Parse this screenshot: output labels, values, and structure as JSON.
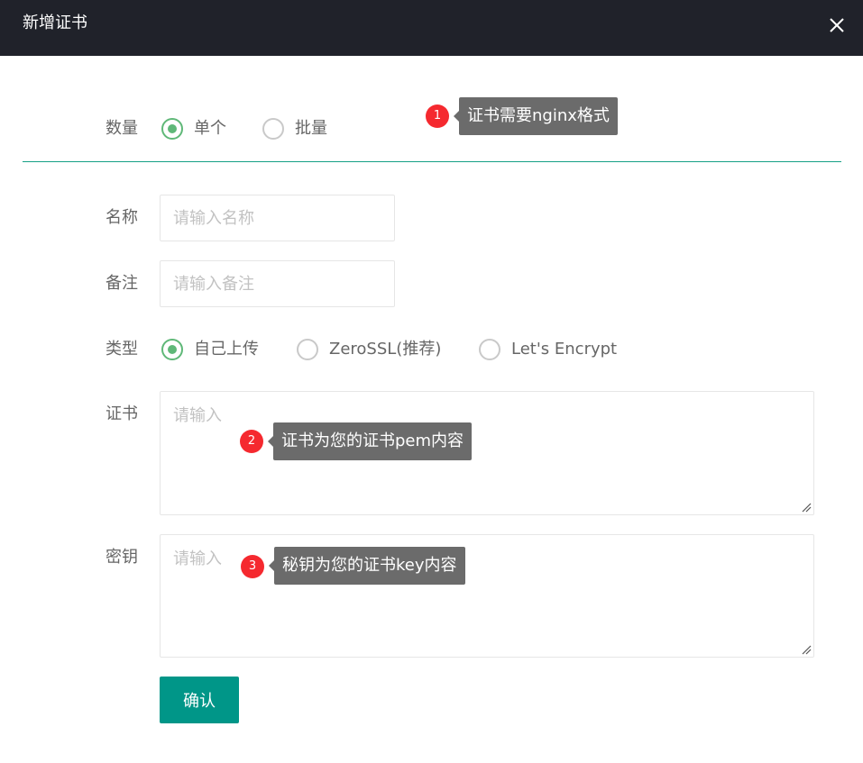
{
  "dialog": {
    "title": "新增证书"
  },
  "form": {
    "quantity": {
      "label": "数量",
      "options": [
        "单个",
        "批量"
      ],
      "selected": "单个"
    },
    "name": {
      "label": "名称",
      "placeholder": "请输入名称",
      "value": ""
    },
    "remark": {
      "label": "备注",
      "placeholder": "请输入备注",
      "value": ""
    },
    "type": {
      "label": "类型",
      "options": [
        "自己上传",
        "ZeroSSL(推荐)",
        "Let's Encrypt"
      ],
      "selected": "自己上传"
    },
    "certificate": {
      "label": "证书",
      "placeholder": "请输入",
      "value": ""
    },
    "key": {
      "label": "密钥",
      "placeholder": "请输入",
      "value": ""
    },
    "submit_label": "确认"
  },
  "annotations": [
    {
      "number": "1",
      "text": "证书需要nginx格式"
    },
    {
      "number": "2",
      "text": "证书为您的证书pem内容"
    },
    {
      "number": "3",
      "text": "秘钥为您的证书key内容"
    }
  ],
  "colors": {
    "header_bg": "#20222a",
    "radio_checked": "#5fb878",
    "divider": "#16a085",
    "primary_button": "#009688",
    "annotation_badge": "#f5292f",
    "annotation_tip": "#6b6b6b"
  }
}
